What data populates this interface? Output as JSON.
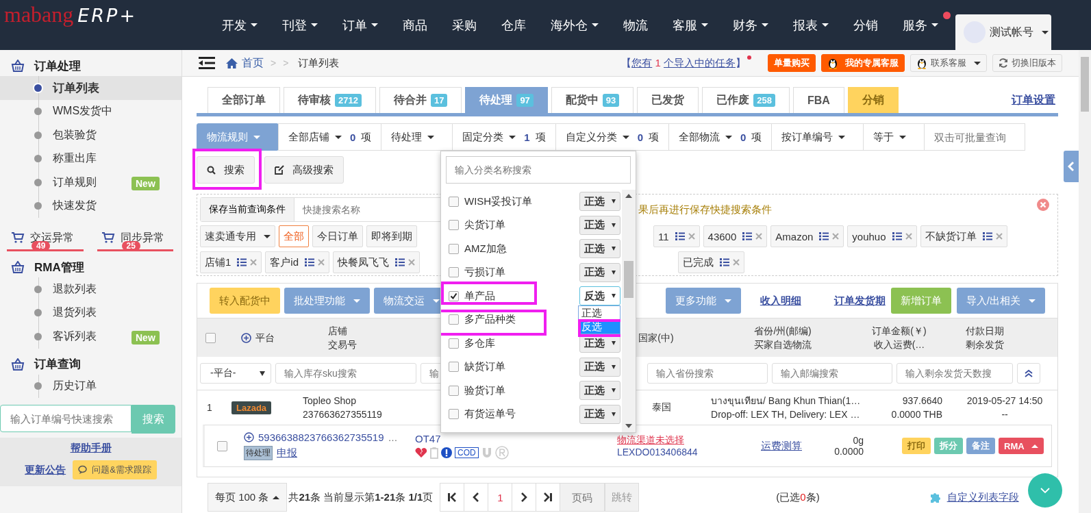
{
  "logo": {
    "brand": "mabang",
    "product": "ERP+"
  },
  "nav": [
    {
      "label": "开发",
      "dropdown": true,
      "dot": false
    },
    {
      "label": "刊登",
      "dropdown": true,
      "dot": false
    },
    {
      "label": "订单",
      "dropdown": true,
      "dot": false
    },
    {
      "label": "商品",
      "dropdown": false,
      "dot": false
    },
    {
      "label": "采购",
      "dropdown": false,
      "dot": false
    },
    {
      "label": "仓库",
      "dropdown": false,
      "dot": false
    },
    {
      "label": "海外仓",
      "dropdown": true,
      "dot": false
    },
    {
      "label": "物流",
      "dropdown": false,
      "dot": false
    },
    {
      "label": "客服",
      "dropdown": true,
      "dot": false
    },
    {
      "label": "财务",
      "dropdown": true,
      "dot": false
    },
    {
      "label": "报表",
      "dropdown": true,
      "dot": false
    },
    {
      "label": "分销",
      "dropdown": false,
      "dot": false
    },
    {
      "label": "服务",
      "dropdown": true,
      "dot": true
    }
  ],
  "account": {
    "name": "测试帐号"
  },
  "sidebar": [
    {
      "kind": "section",
      "title": "订单处理",
      "items": [
        {
          "label": "订单列表",
          "selected": true
        },
        {
          "label": "WMS发货中",
          "selected": false
        },
        {
          "label": "包装验货",
          "selected": false
        },
        {
          "label": "称重出库",
          "selected": false
        },
        {
          "label": "订单规则",
          "selected": false,
          "badge": "New"
        },
        {
          "label": "快速发货",
          "selected": false
        }
      ]
    },
    {
      "kind": "alerts",
      "items": [
        {
          "label": "交运异常",
          "count": "49"
        },
        {
          "label": "同步异常",
          "count": "25"
        }
      ]
    },
    {
      "kind": "section",
      "title": "RMA管理",
      "items": [
        {
          "label": "退款列表",
          "selected": false
        },
        {
          "label": "退货列表",
          "selected": false
        },
        {
          "label": "客诉列表",
          "selected": false,
          "badge": "New"
        }
      ]
    },
    {
      "kind": "section",
      "title": "订单查询",
      "items": [
        {
          "label": "历史订单",
          "selected": false
        }
      ]
    }
  ],
  "quick_search": {
    "placeholder": "输入订单编号快速搜索",
    "button": "搜索"
  },
  "help_link": "帮助手册",
  "announce_link": "更新公告",
  "feedback_button": "问题&需求跟踪",
  "breadcrumb": [
    {
      "label": "首页",
      "kind": "home"
    },
    {
      "label": ">",
      "kind": "sep"
    },
    {
      "label": ">",
      "kind": "sep"
    },
    {
      "label": "订单列表",
      "kind": "current"
    }
  ],
  "task_notice": {
    "open": "【",
    "link1": "您有",
    "count": "1",
    "link2": "个导入中的任务",
    "close": "】"
  },
  "header_buttons": [
    {
      "label": "单量购买",
      "kind": "orange"
    },
    {
      "label": "我的专属客服",
      "kind": "orange-qq"
    },
    {
      "label": "联系客服",
      "kind": "qq-dropdown"
    },
    {
      "label": "切换旧版本",
      "kind": "refresh"
    }
  ],
  "tabs": [
    {
      "label": "全部订单",
      "selected": false,
      "kind": "normal"
    },
    {
      "label": "待审核",
      "count": "2712",
      "selected": false,
      "kind": "normal"
    },
    {
      "label": "待合并",
      "count": "17",
      "selected": false,
      "kind": "normal"
    },
    {
      "label": "待处理",
      "count": "97",
      "selected": true,
      "kind": "normal"
    },
    {
      "label": "配货中",
      "count": "93",
      "selected": false,
      "kind": "normal"
    },
    {
      "label": "已发货",
      "selected": false,
      "kind": "normal"
    },
    {
      "label": "已作废",
      "count": "258",
      "selected": false,
      "kind": "normal"
    },
    {
      "label": "FBA",
      "selected": false,
      "kind": "normal"
    },
    {
      "label": "分销",
      "selected": false,
      "kind": "yellow"
    }
  ],
  "settings_link": "订单设置",
  "filters": [
    {
      "kind": "primary",
      "label": "物流规则"
    },
    {
      "kind": "select",
      "label": "全部店铺",
      "count": "0",
      "unit": "项"
    },
    {
      "kind": "select",
      "label": "待处理"
    },
    {
      "kind": "select",
      "label": "固定分类",
      "count": "1",
      "unit": "项"
    },
    {
      "kind": "select",
      "label": "自定义分类",
      "count": "0",
      "unit": "项"
    },
    {
      "kind": "select",
      "label": "全部物流",
      "count": "0",
      "unit": "项"
    },
    {
      "kind": "select",
      "label": "按订单编号"
    },
    {
      "kind": "select",
      "label": "等于"
    },
    {
      "kind": "input",
      "placeholder": "双击可批量查询"
    }
  ],
  "search_buttons": [
    {
      "label": "搜索",
      "highlighted": true
    },
    {
      "label": "高级搜索",
      "highlighted": false
    }
  ],
  "quick_filter": {
    "save_button": "保存当前查询条件",
    "name_placeholder": "快捷搜索名称",
    "hint": "果后再进行保存快捷搜索条件",
    "row1_left": [
      {
        "label": "速卖通专用",
        "kind": "dropdown"
      },
      {
        "label": "全部",
        "kind": "active"
      },
      {
        "label": "今日订单",
        "kind": "plain"
      },
      {
        "label": "即将到期",
        "kind": "plain"
      }
    ],
    "row1_right": [
      {
        "label": "11",
        "kind": "saved"
      },
      {
        "label": "43600",
        "kind": "saved"
      },
      {
        "label": "Amazon",
        "kind": "saved"
      },
      {
        "label": "youhuo",
        "kind": "saved"
      },
      {
        "label": "不缺货订单",
        "kind": "saved"
      }
    ],
    "row2_left": [
      {
        "label": "店铺1",
        "kind": "saved"
      },
      {
        "label": "客户id",
        "kind": "saved"
      },
      {
        "label": "快餐凤飞飞",
        "kind": "saved"
      }
    ],
    "row2_right": [
      {
        "label": "已完成",
        "kind": "saved"
      }
    ]
  },
  "actions_left": [
    {
      "label": "转入配货中",
      "kind": "yellow"
    },
    {
      "label": "批处理功能",
      "kind": "blue-dropdown"
    },
    {
      "label": "物流交运",
      "kind": "blue-dropdown"
    }
  ],
  "actions_right": [
    {
      "label": "更多功能",
      "kind": "blue-dropdown"
    },
    {
      "label": "收入明细",
      "kind": "link"
    },
    {
      "label": "订单发货期",
      "kind": "link"
    },
    {
      "label": "新增订单",
      "kind": "green"
    },
    {
      "label": "导入/出相关",
      "kind": "blue-dropdown"
    }
  ],
  "select_all": {
    "checked": false
  },
  "columns": [
    {
      "lines": [
        "平台"
      ],
      "kind": "platform"
    },
    {
      "lines": [
        "店铺",
        "交易号"
      ],
      "kind": "shop"
    },
    {
      "lines": [
        "国家(中)"
      ],
      "kind": "country"
    },
    {
      "lines": [
        "省份/州(邮编)",
        "买家自选物流"
      ],
      "kind": "province"
    },
    {
      "lines": [
        "订单金额(￥)",
        "收入运费(…"
      ],
      "kind": "amount"
    },
    {
      "lines": [
        "付款日期",
        "剩余发货"
      ],
      "kind": "date"
    }
  ],
  "column_filters": [
    {
      "kind": "select",
      "value": "-平台-"
    },
    {
      "kind": "input",
      "placeholder": "输入库存sku搜索"
    },
    {
      "kind": "input",
      "placeholder": "输"
    },
    {
      "kind": "input",
      "placeholder": "输入省份搜索"
    },
    {
      "kind": "input",
      "placeholder": "输入邮编搜索"
    },
    {
      "kind": "input",
      "placeholder": "输入剩余发货天数搜"
    }
  ],
  "order": {
    "index": "1",
    "platform": "Lazada",
    "shop": "Topleo Shop",
    "trade_no": "237663627355119",
    "country": "泰国",
    "province": "บางขุนเทียน/ Bang Khun Thian(1…",
    "logistics": "Drop-off: LEX TH, Delivery: LEX …",
    "amount": "937.6640",
    "freight": "0.0000 THB",
    "paid": "2019-05-27 14:50",
    "remaining": "--",
    "sub": {
      "checked": false,
      "order_no": "5936638823766362735519",
      "more": "…",
      "status": "待处理",
      "declare": "申报",
      "code": "OT47",
      "cod": "COD",
      "channel": "物流渠道未选择",
      "tracking": "LEXDO013406844",
      "estimate": "运费测算",
      "weight": "0g",
      "cost": "0.0000",
      "buttons": [
        {
          "label": "打印",
          "kind": "yellow"
        },
        {
          "label": "拆分",
          "kind": "teal"
        },
        {
          "label": "备注",
          "kind": "blue"
        },
        {
          "label": "RMA",
          "kind": "red-up"
        }
      ]
    }
  },
  "pager": {
    "page_size": "每页 100 条",
    "summary": "共**21**条 当前显示第**1-21**条 **1/1**页",
    "current": "1",
    "page_placeholder": "页码",
    "jump": "跳转",
    "selected_prefix": "(已选",
    "selected_count": "0",
    "selected_suffix": "条)",
    "custom_link": "自定义列表字段"
  },
  "category_dropdown": {
    "placeholder": "输入分类名称搜索",
    "items": [
      {
        "label": "WISH妥投订单",
        "checked": false,
        "mode": "正选",
        "highlighted": false
      },
      {
        "label": "尖货订单",
        "checked": false,
        "mode": "正选",
        "highlighted": false
      },
      {
        "label": "AMZ加急",
        "checked": false,
        "mode": "正选",
        "highlighted": false
      },
      {
        "label": "亏损订单",
        "checked": false,
        "mode": "正选",
        "highlighted": false
      },
      {
        "label": "单产品",
        "checked": true,
        "mode": "反选",
        "highlighted": true,
        "options": [
          {
            "label": "正选",
            "selected": false,
            "highlighted": false
          },
          {
            "label": "反选",
            "selected": true,
            "highlighted": true
          }
        ]
      },
      {
        "label": "多产品种类",
        "checked": false,
        "highlighted": true
      },
      {
        "label": "多仓库",
        "checked": false,
        "mode": "正选",
        "highlighted": false
      },
      {
        "label": "缺货订单",
        "checked": false,
        "mode": "正选",
        "highlighted": false
      },
      {
        "label": "验货订单",
        "checked": false,
        "mode": "正选",
        "highlighted": false
      },
      {
        "label": "有货运单号",
        "checked": false,
        "mode": "正选",
        "highlighted": false
      }
    ]
  }
}
